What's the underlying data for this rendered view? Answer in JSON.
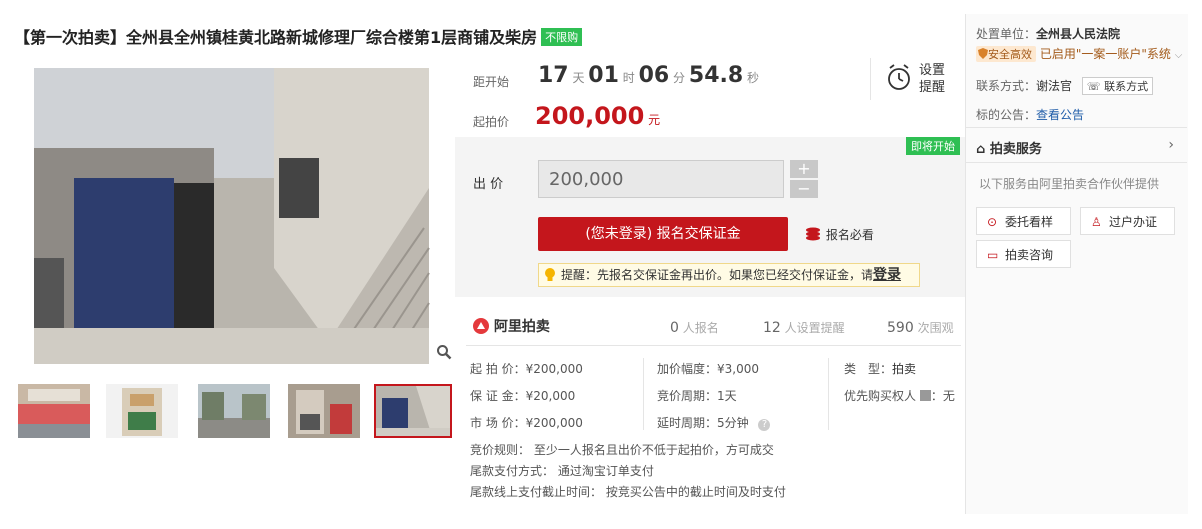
{
  "header": {
    "title": "【第一次拍卖】全州县全州镇桂黄北路新城修理厂综合楼第1层商铺及柴房",
    "badge": "不限购"
  },
  "countdown": {
    "label": "距开始",
    "days": "17",
    "days_unit": "天",
    "hours": "01",
    "hours_unit": "时",
    "minutes": "06",
    "minutes_unit": "分",
    "seconds": "54.8",
    "seconds_unit": "秒",
    "reminder_line1": "设置",
    "reminder_line2": "提醒"
  },
  "start_price": {
    "label": "起拍价",
    "value": "200,000",
    "unit": "元"
  },
  "bid": {
    "status_tag": "即将开始",
    "label": "出 价",
    "input_value": "200,000",
    "plus": "+",
    "minus": "−",
    "signup_button": "(您未登录) 报名交保证金",
    "must_read": "报名必看",
    "notice_text": "提醒：先报名交保证金再出价。如果您已经交付保证金，请",
    "notice_link": "登录"
  },
  "platform": {
    "name": "阿里拍卖",
    "signups_num": "0",
    "signups_lbl": "人报名",
    "reminders_num": "12",
    "reminders_lbl": "人设置提醒",
    "views_num": "590",
    "views_lbl": "次围观"
  },
  "details": {
    "col1": [
      "起 拍 价：¥200,000",
      "保 证 金：¥20,000",
      "市 场 价：¥200,000"
    ],
    "col2": [
      "加价幅度：¥3,000",
      "竞价周期：1天",
      "延时周期：5分钟"
    ],
    "type_label": "类　型：",
    "type_value": "拍卖",
    "priority_label": "优先购买权人",
    "priority_value": "：无",
    "rules": [
      "竞价规则：  至少一人报名且出价不低于起拍价，方可成交",
      "尾款支付方式：  通过淘宝订单支付",
      "尾款线上支付截止时间：  按竞买公告中的截止时间及时支付"
    ]
  },
  "right": {
    "unit_label": "处置单位：",
    "unit_value": "全州县人民法院",
    "security_badge": "安全高效",
    "security_text": "已启用\"一案一账户\"系统",
    "contact_label": "联系方式：",
    "contact_name": "谢法官",
    "contact_btn": "联系方式",
    "notice_label": "标的公告：",
    "notice_link": "查看公告",
    "service_title": "拍卖服务",
    "service_desc": "以下服务由阿里拍卖合作伙伴提供",
    "services": [
      "委托看样",
      "过户办证",
      "拍卖咨询"
    ]
  },
  "colors": {
    "accent_red": "#c4161c",
    "green_tag": "#2fbf53",
    "link_blue": "#1f5ca8"
  }
}
